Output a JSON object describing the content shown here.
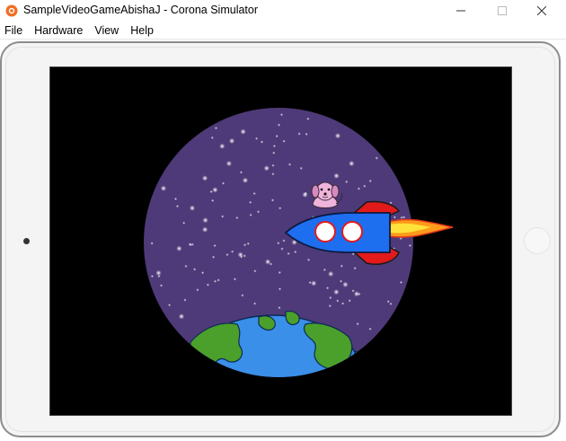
{
  "window": {
    "title": "SampleVideoGameAbishaJ - Corona Simulator",
    "app_icon": "corona-simulator-icon",
    "controls": [
      "minimize-icon",
      "maximize-icon",
      "close-icon"
    ]
  },
  "menu": {
    "items": [
      {
        "label": "File"
      },
      {
        "label": "Hardware"
      },
      {
        "label": "View"
      },
      {
        "label": "Help"
      }
    ]
  },
  "device": {
    "type": "tablet",
    "bezel_color": "#f4f4f4"
  },
  "scene": {
    "background": "#000000",
    "space_color": "#4e3a78",
    "earth_ocean": "#3a8fe8",
    "earth_land": "#4aa02a",
    "rocket_body": "#1e6ef0",
    "rocket_fins": "#e21a1a",
    "dog_color": "#f0b4dc",
    "flame_color": "#ff9a1a"
  }
}
